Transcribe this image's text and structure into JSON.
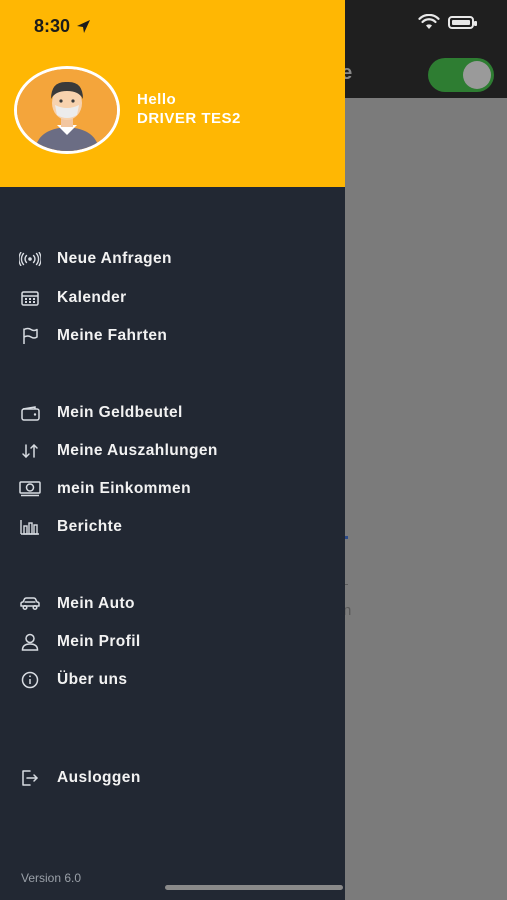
{
  "status_bar": {
    "time": "8:30"
  },
  "background": {
    "title_fragment": "se",
    "text_fragment": "n"
  },
  "drawer": {
    "greeting": "Hello",
    "user_name": "DRIVER TES2",
    "menu": [
      {
        "label": "Neue Anfragen",
        "icon": "radio-signal-icon"
      },
      {
        "label": "Kalender",
        "icon": "calendar-icon"
      },
      {
        "label": "Meine Fahrten",
        "icon": "flag-icon"
      },
      {
        "label": "Mein Geldbeutel",
        "icon": "wallet-icon"
      },
      {
        "label": "Meine Auszahlungen",
        "icon": "transfer-arrows-icon"
      },
      {
        "label": "mein Einkommen",
        "icon": "money-icon"
      },
      {
        "label": "Berichte",
        "icon": "bar-chart-icon"
      },
      {
        "label": "Mein Auto",
        "icon": "car-icon"
      },
      {
        "label": "Mein Profil",
        "icon": "user-icon"
      },
      {
        "label": "Über uns",
        "icon": "info-icon"
      },
      {
        "label": "Ausloggen",
        "icon": "logout-icon"
      }
    ],
    "version": "Version 6.0"
  },
  "colors": {
    "header_yellow": "#ffb703",
    "drawer_bg": "#222833",
    "toggle_green": "#2e7d32"
  }
}
